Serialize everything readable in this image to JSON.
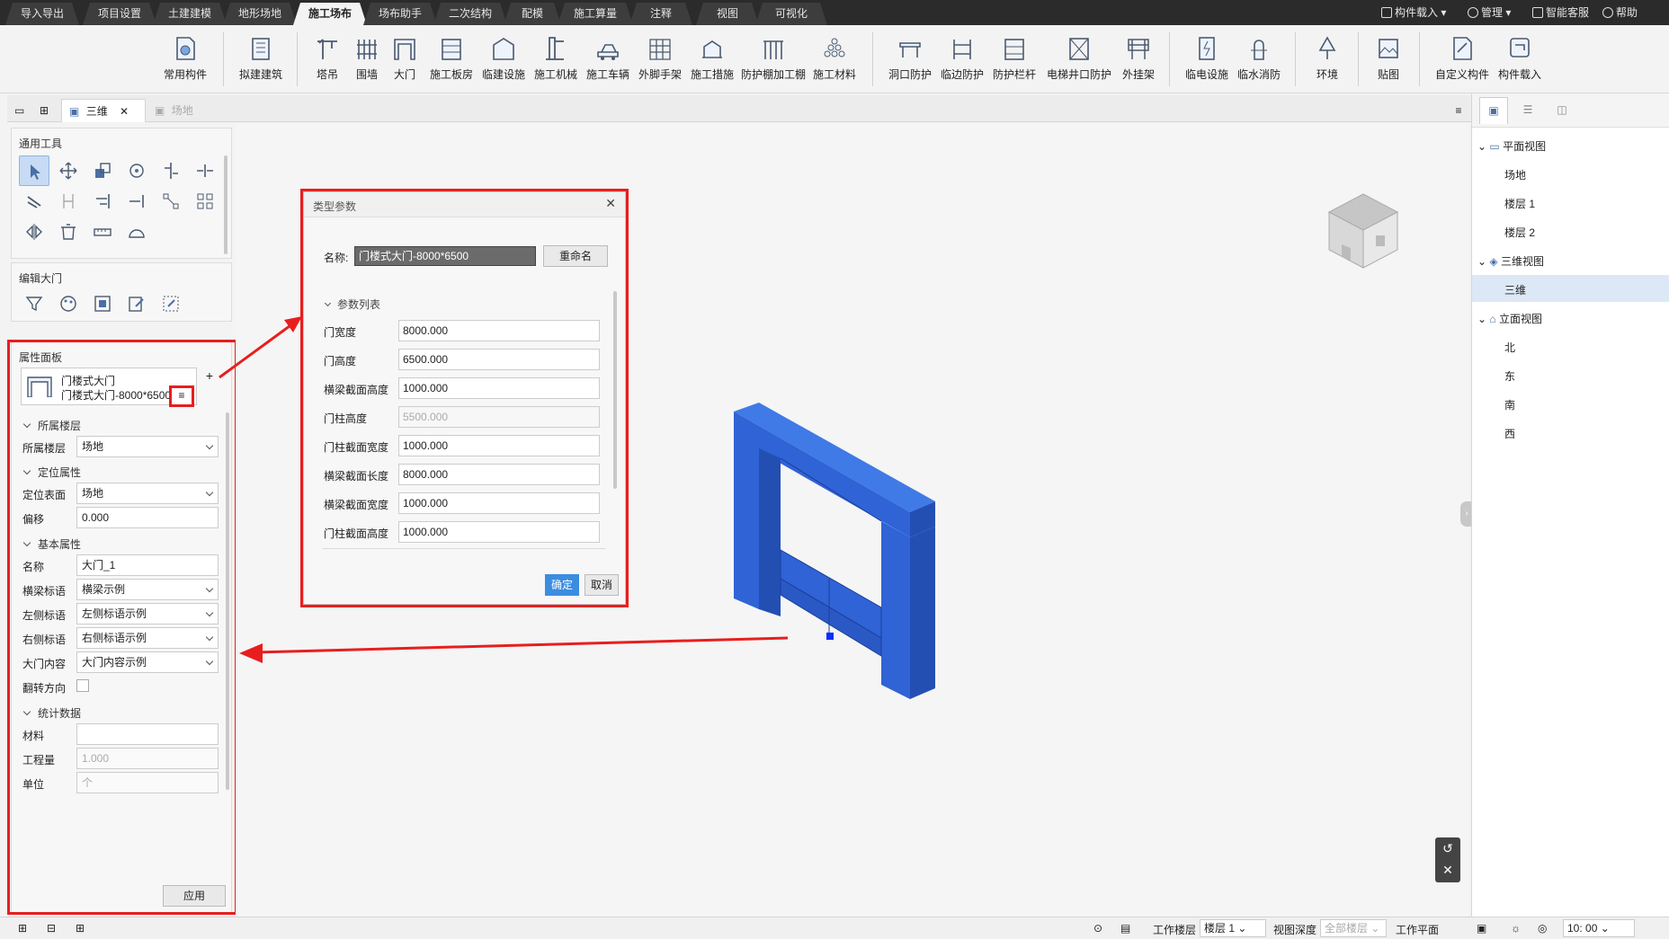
{
  "menu": {
    "tabs": [
      "导入导出",
      "项目设置",
      "土建建模",
      "地形场地",
      "施工场布",
      "场布助手",
      "二次结构",
      "配模",
      "施工算量",
      "注释",
      "视图",
      "可视化"
    ],
    "active_tab": "施工场布",
    "right_items": [
      "构件载入",
      "管理",
      "智能客服",
      "帮助"
    ]
  },
  "ribbon": {
    "buttons": [
      "常用构件",
      "拟建建筑",
      "塔吊",
      "围墙",
      "大门",
      "施工板房",
      "临建设施",
      "施工机械",
      "施工车辆",
      "外脚手架",
      "施工措施",
      "防护棚加工棚",
      "施工材料",
      "洞口防护",
      "临边防护",
      "防护栏杆",
      "电梯井口防护",
      "外挂架",
      "临电设施",
      "临水消防",
      "环境",
      "贴图",
      "自定义构件",
      "构件载入"
    ]
  },
  "doc_tabs": {
    "tab1": "三维",
    "tab2": "场地"
  },
  "left": {
    "tools_title": "通用工具",
    "edit_title": "编辑大门",
    "prop_title": "属性面板",
    "component_name": "门楼式大门",
    "component_type": "门楼式大门-8000*6500",
    "groups": {
      "floor": "所属楼层",
      "position": "定位属性",
      "basic": "基本属性",
      "stats": "统计数据"
    },
    "fields": {
      "floor_label": "所属楼层",
      "floor_value": "场地",
      "surface_label": "定位表面",
      "surface_value": "场地",
      "offset_label": "偏移",
      "offset_value": "0.000",
      "name_label": "名称",
      "name_value": "大门_1",
      "beam_label": "横梁标语",
      "beam_value": "横梁示例",
      "left_label": "左侧标语",
      "left_value": "左侧标语示例",
      "right_label": "右侧标语",
      "right_value": "右侧标语示例",
      "content_label": "大门内容",
      "content_value": "大门内容示例",
      "flip_label": "翻转方向",
      "material_label": "材料",
      "material_value": "",
      "qty_label": "工程量",
      "qty_value": "1.000",
      "unit_label": "单位",
      "unit_value": "个"
    },
    "apply_label": "应用"
  },
  "dialog": {
    "title": "类型参数",
    "name_label": "名称:",
    "name_value": "门楼式大门-8000*6500",
    "rename_label": "重命名",
    "list_title": "参数列表",
    "params": [
      {
        "label": "门宽度",
        "value": "8000.000",
        "disabled": false
      },
      {
        "label": "门高度",
        "value": "6500.000",
        "disabled": false
      },
      {
        "label": "横梁截面高度",
        "value": "1000.000",
        "disabled": false
      },
      {
        "label": "门柱高度",
        "value": "5500.000",
        "disabled": true
      },
      {
        "label": "门柱截面宽度",
        "value": "1000.000",
        "disabled": false
      },
      {
        "label": "横梁截面长度",
        "value": "8000.000",
        "disabled": false
      },
      {
        "label": "横梁截面宽度",
        "value": "1000.000",
        "disabled": false
      },
      {
        "label": "门柱截面高度",
        "value": "1000.000",
        "disabled": false
      }
    ],
    "ok_label": "确定",
    "cancel_label": "取消"
  },
  "tree": {
    "plan": "平面视图",
    "plan_items": [
      "场地",
      "楼层 1",
      "楼层 2"
    ],
    "threed": "三维视图",
    "threed_items": [
      "三维"
    ],
    "elev": "立面视图",
    "elev_items": [
      "北",
      "东",
      "南",
      "西"
    ]
  },
  "status": {
    "floor_label": "工作楼层",
    "floor_value": "楼层 1",
    "depth_label": "视图深度",
    "depth_value": "全部楼层",
    "plane_label": "工作平面",
    "time_value": "10: 00"
  },
  "colors": {
    "accent": "#3b8de0",
    "highlight": "#e81e1e",
    "gate_blue": "#2f63d6"
  }
}
